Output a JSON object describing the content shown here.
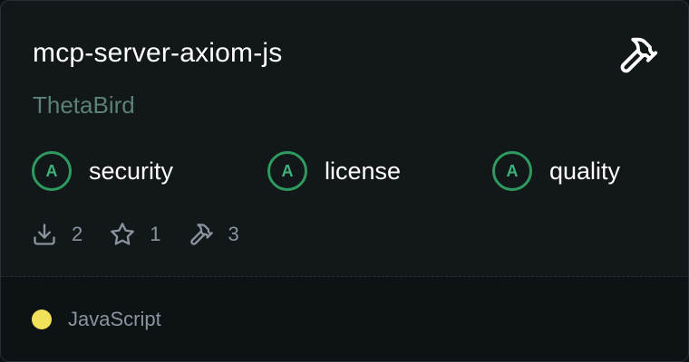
{
  "card": {
    "repo_name": "mcp-server-axiom-js",
    "owner": "ThetaBird",
    "grades": [
      {
        "grade": "A",
        "label": "security"
      },
      {
        "grade": "A",
        "label": "license"
      },
      {
        "grade": "A",
        "label": "quality"
      }
    ],
    "stats": {
      "downloads": "2",
      "stars": "1",
      "tools": "3"
    },
    "language": {
      "name": "JavaScript",
      "color": "#f1e05a"
    },
    "icons": {
      "main": "hammer-icon",
      "downloads": "download-icon",
      "stars": "star-icon",
      "tools": "hammer-icon"
    }
  }
}
